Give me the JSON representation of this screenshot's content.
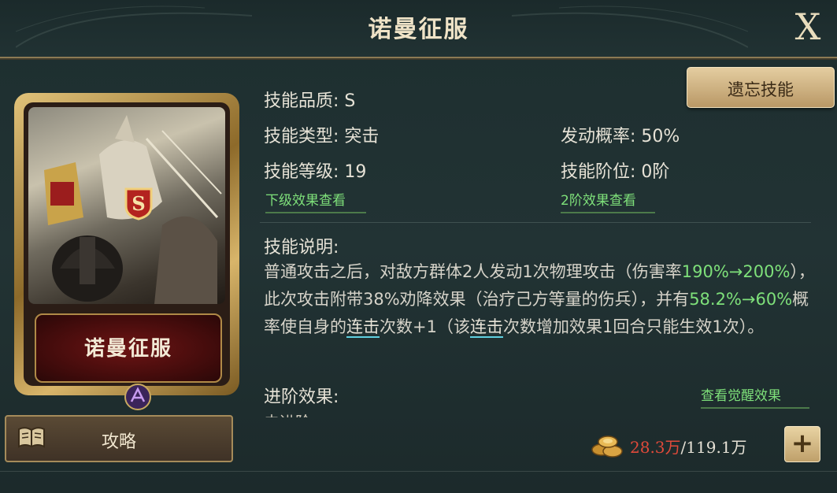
{
  "header": {
    "title": "诺曼征服",
    "close_label": "X"
  },
  "card": {
    "name": "诺曼征服",
    "grade_badge": "S"
  },
  "guide_button": {
    "label": "攻略"
  },
  "forget_button": {
    "label": "遗忘技能"
  },
  "info": {
    "quality": "技能品质: S",
    "type": "技能类型: 突击",
    "level": "技能等级: 19",
    "trigger_rate": "发动概率: 50%",
    "tier": "技能阶位: 0阶",
    "next_level_link": "下级效果查看",
    "tier2_link": "2阶效果查看"
  },
  "description": {
    "label": "技能说明:",
    "p1": "普通攻击之后，对敌方群体2人发动1次物理攻击（伤害率",
    "g1": "190%→200%",
    "p2": "），此次攻击附带38%劝降效果（治疗己方等量的伤兵），并有",
    "g2": "58.2%→60%",
    "p3": "概率使自身的",
    "kw1": "连击",
    "p4": "次数+1（该",
    "kw2": "连击",
    "p5": "次数增加效果1回合只能生效1次）。"
  },
  "advanced": {
    "label": "进阶效果:",
    "awaken_link": "查看觉醒效果",
    "next_text": "未进阶"
  },
  "resource": {
    "current": "28.3万",
    "separator": "/",
    "max": "119.1万",
    "icon": "coin-stack-icon"
  },
  "colors": {
    "green": "#7ee07a",
    "red": "#e04a3a",
    "gold": "#d8b56a"
  }
}
